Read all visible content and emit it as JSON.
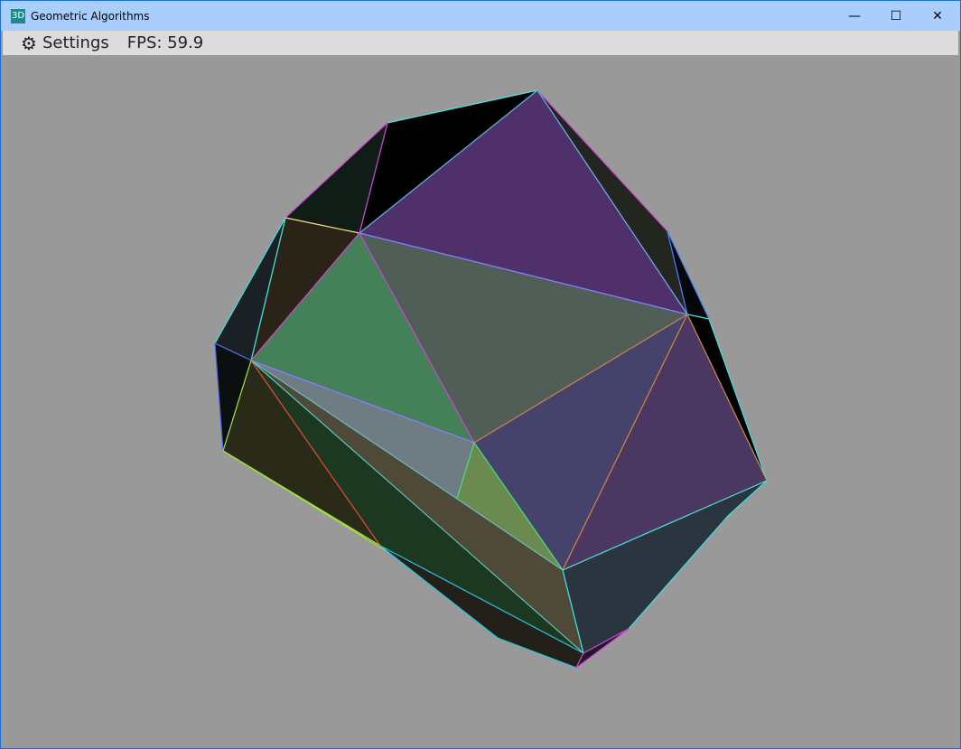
{
  "window": {
    "title": "Geometric Algorithms",
    "app_icon": "3D",
    "minimize": "—",
    "maximize": "☐",
    "close": "✕"
  },
  "menubar": {
    "settings_icon": "gear-icon",
    "settings_label": "Settings",
    "fps_label": "FPS: 59.9"
  },
  "viewport": {
    "background": "#999999"
  }
}
